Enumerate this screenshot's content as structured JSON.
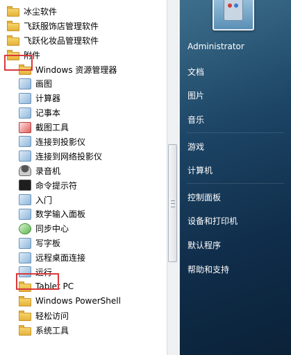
{
  "programs": [
    {
      "label": "冰尘软件",
      "icon": "folder-icon",
      "level": "top"
    },
    {
      "label": "飞跃服饰店管理软件",
      "icon": "folder-icon",
      "level": "top"
    },
    {
      "label": "飞跃化妆品管理软件",
      "icon": "folder-icon",
      "level": "top"
    },
    {
      "label": "附件",
      "icon": "folder-icon",
      "level": "top"
    },
    {
      "label": "Windows 资源管理器",
      "icon": "explorer-icon",
      "level": "sub"
    },
    {
      "label": "画图",
      "icon": "paint-icon",
      "level": "sub"
    },
    {
      "label": "计算器",
      "icon": "calculator-icon",
      "level": "sub"
    },
    {
      "label": "记事本",
      "icon": "notepad-icon",
      "level": "sub"
    },
    {
      "label": "截图工具",
      "icon": "snipping-tool-icon",
      "level": "sub"
    },
    {
      "label": "连接到投影仪",
      "icon": "projector-icon",
      "level": "sub"
    },
    {
      "label": "连接到网络投影仪",
      "icon": "network-projector-icon",
      "level": "sub"
    },
    {
      "label": "录音机",
      "icon": "microphone-icon",
      "level": "sub"
    },
    {
      "label": "命令提示符",
      "icon": "command-prompt-icon",
      "level": "sub"
    },
    {
      "label": "入门",
      "icon": "getting-started-icon",
      "level": "sub"
    },
    {
      "label": "数学输入面板",
      "icon": "math-input-icon",
      "level": "sub"
    },
    {
      "label": "同步中心",
      "icon": "sync-center-icon",
      "level": "sub"
    },
    {
      "label": "写字板",
      "icon": "wordpad-icon",
      "level": "sub"
    },
    {
      "label": "远程桌面连接",
      "icon": "remote-desktop-icon",
      "level": "sub"
    },
    {
      "label": "运行",
      "icon": "run-icon",
      "level": "sub"
    },
    {
      "label": "Tablet PC",
      "icon": "folder-icon",
      "level": "sub"
    },
    {
      "label": "Windows PowerShell",
      "icon": "folder-icon",
      "level": "sub"
    },
    {
      "label": "轻松访问",
      "icon": "folder-icon",
      "level": "sub"
    },
    {
      "label": "系统工具",
      "icon": "folder-icon",
      "level": "sub"
    }
  ],
  "right_menu": {
    "user": "Administrator",
    "documents": "文档",
    "pictures": "图片",
    "music": "音乐",
    "games": "游戏",
    "computer": "计算机",
    "control_panel": "控制面板",
    "devices_printers": "设备和打印机",
    "default_programs": "默认程序",
    "help_support": "帮助和支持"
  },
  "colors": {
    "highlight_border": "#d9383b",
    "right_pane": "#1d4566"
  }
}
